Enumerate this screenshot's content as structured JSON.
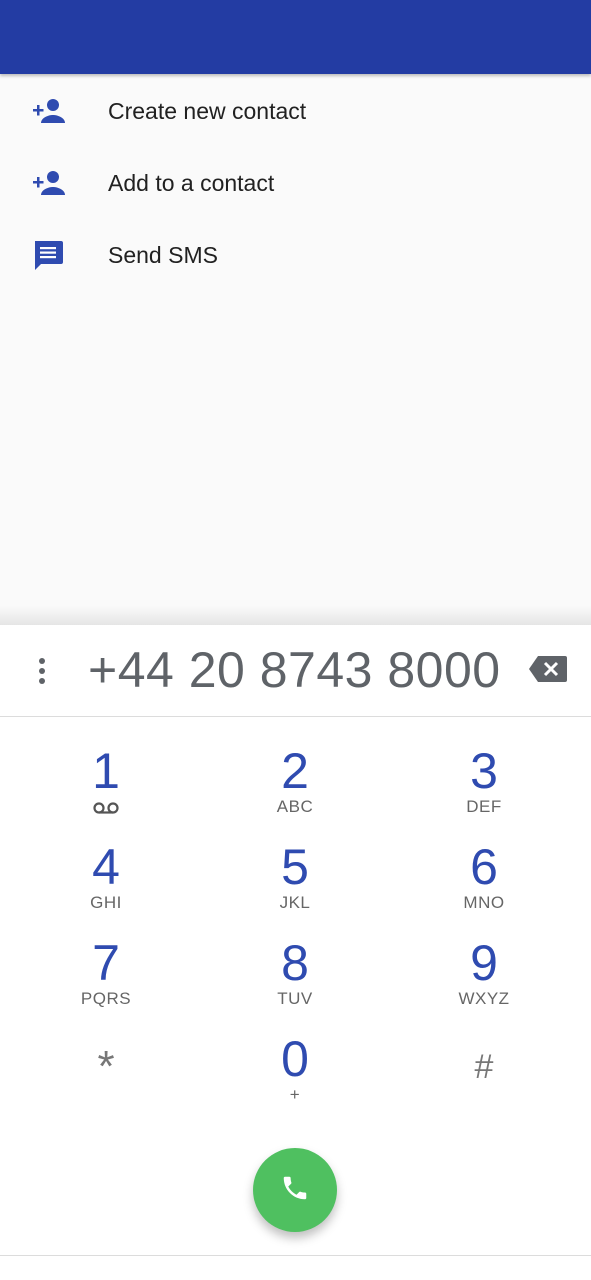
{
  "colors": {
    "appbar": "#233ca3",
    "accent": "#2f4bb0",
    "call": "#4fc060"
  },
  "menu": {
    "items": [
      {
        "icon": "person-add-icon",
        "label": "Create new contact"
      },
      {
        "icon": "person-add-icon",
        "label": "Add to a contact"
      },
      {
        "icon": "message-icon",
        "label": "Send SMS"
      }
    ]
  },
  "dialer": {
    "number": "+44 20 8743 8000",
    "keys": [
      {
        "digit": "1",
        "letters": "",
        "icon": "voicemail-icon"
      },
      {
        "digit": "2",
        "letters": "ABC"
      },
      {
        "digit": "3",
        "letters": "DEF"
      },
      {
        "digit": "4",
        "letters": "GHI"
      },
      {
        "digit": "5",
        "letters": "JKL"
      },
      {
        "digit": "6",
        "letters": "MNO"
      },
      {
        "digit": "7",
        "letters": "PQRS"
      },
      {
        "digit": "8",
        "letters": "TUV"
      },
      {
        "digit": "9",
        "letters": "WXYZ"
      },
      {
        "digit": "*",
        "letters": ""
      },
      {
        "digit": "0",
        "letters": "+"
      },
      {
        "digit": "#",
        "letters": ""
      }
    ]
  }
}
